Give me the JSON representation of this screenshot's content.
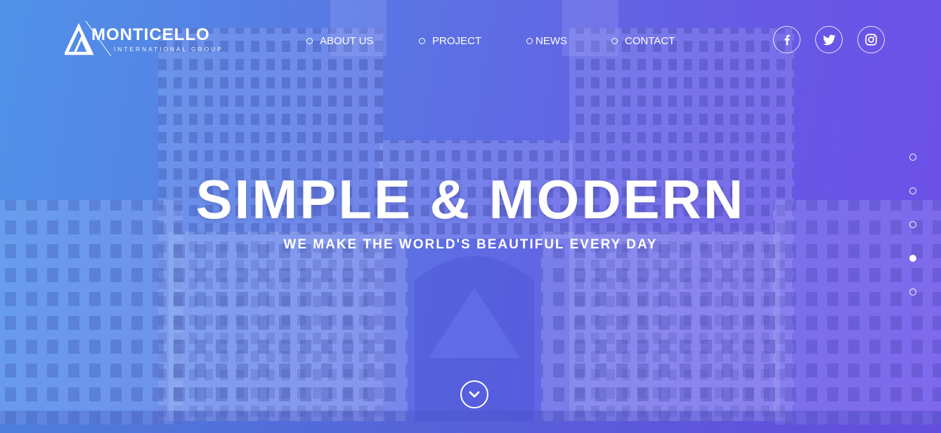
{
  "brand": {
    "name": "MONTICELLO",
    "tagline": "INTERNATIONAL GROUP"
  },
  "nav": {
    "items": [
      {
        "label": "ABOUT US"
      },
      {
        "label": "PROJECT"
      },
      {
        "label": "NEWS"
      },
      {
        "label": "CONTACT"
      }
    ]
  },
  "social": {
    "icons": [
      "facebook-icon",
      "twitter-icon",
      "instagram-icon"
    ]
  },
  "hero": {
    "title": "SIMPLE & MODERN",
    "subtitle": "WE MAKE THE WORLD'S BEAUTIFUL EVERY DAY"
  },
  "slider": {
    "slide_count": 5,
    "active_slide": 4
  },
  "colors": {
    "accent": "#ffffff",
    "overlay_left": "#4f8fe6",
    "overlay_right": "#6e4ee6"
  }
}
